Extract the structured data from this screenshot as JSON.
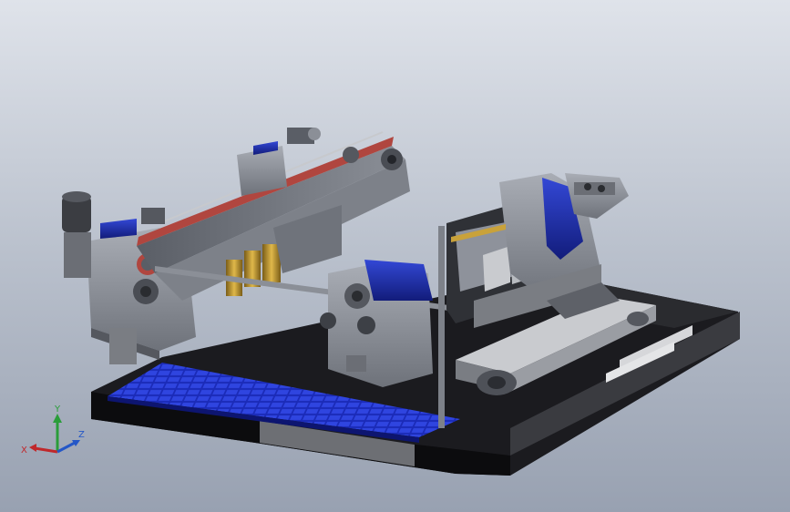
{
  "triad": {
    "x_label": "X",
    "y_label": "Y",
    "z_label": "Z",
    "x_color": "#c0282b",
    "y_color": "#2a9d3a",
    "z_color": "#2457c7"
  },
  "colors": {
    "background_top": "#dfe3ea",
    "background_bottom": "#98a1b1",
    "machine_gray": "#8e929b",
    "accent_blue": "#1f2ea8",
    "belt_red": "#b0463f",
    "shaft_yellow": "#c9a23a",
    "base_black": "#0e0e10"
  }
}
